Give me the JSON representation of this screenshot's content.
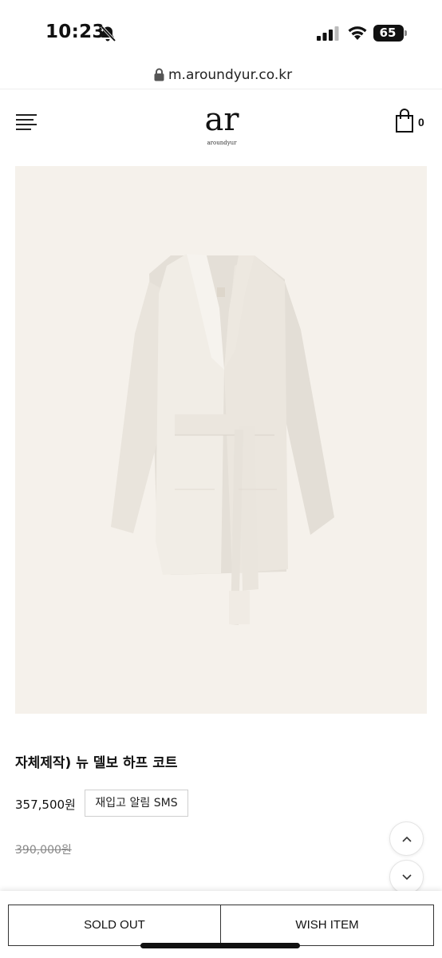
{
  "status_bar": {
    "time": "10:23",
    "battery": "65",
    "icons": [
      "bell-slash-icon",
      "signal-icon",
      "wifi-icon",
      "battery-icon"
    ]
  },
  "browser": {
    "url": "m.aroundyur.co.kr",
    "icons": [
      "lock-icon"
    ]
  },
  "header": {
    "logo_mark": "ar",
    "logo_sub": "aroundyur",
    "cart_count": "0",
    "icons": [
      "hamburger-menu-icon",
      "shopping-bag-icon"
    ]
  },
  "product": {
    "image": "cream-wool-half-coat-with-belt",
    "title": "자체제작) 뉴 델보 하프 코트",
    "price": "357,500원",
    "restock_button": "재입고 알림 SMS",
    "original_price": "390,000원"
  },
  "scroll_buttons": {
    "icons": [
      "chevron-up-icon",
      "chevron-down-icon"
    ]
  },
  "bottom_bar": {
    "sold_out": "SOLD OUT",
    "wish_item": "WISH ITEM"
  },
  "colors": {
    "image_background": "#f5f1eb",
    "coat": "#efebe5",
    "text": "#111111",
    "muted_text": "#888888"
  }
}
